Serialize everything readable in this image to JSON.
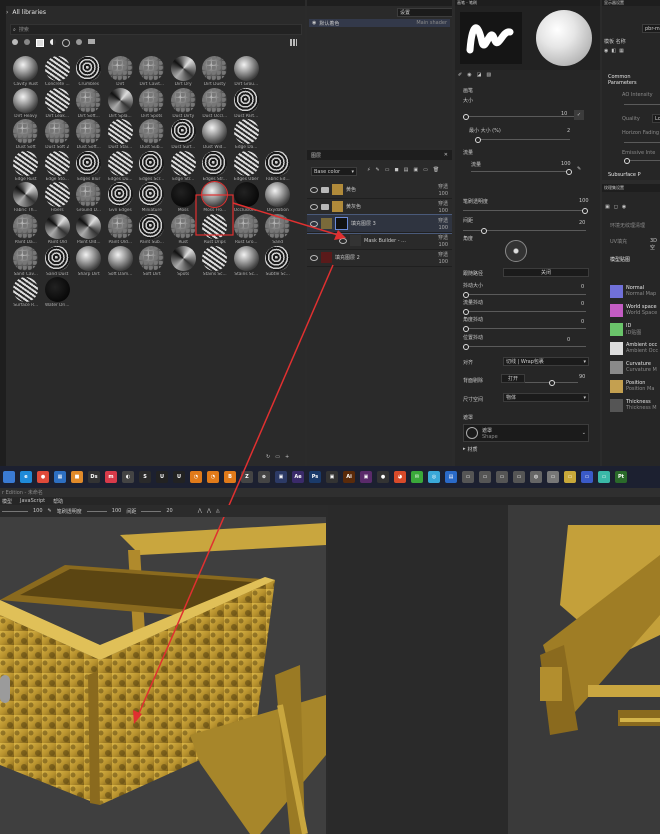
{
  "library": {
    "breadcrumb": "All libraries",
    "search_placeholder": "搜索",
    "items": [
      {
        "label": "Cavity Rust",
        "v": "v2"
      },
      {
        "label": "Concrete ...",
        "v": "v1"
      },
      {
        "label": "Crumbles",
        "v": "v4"
      },
      {
        "label": "Dirt",
        "v": "v3"
      },
      {
        "label": "Dirt Cavit...",
        "v": "v3"
      },
      {
        "label": "Dirt Dry",
        "v": "v6"
      },
      {
        "label": "Dirt Dusty",
        "v": "v3"
      },
      {
        "label": "Dirt Grou...",
        "v": "v2"
      },
      {
        "label": "",
        "v": ""
      },
      {
        "label": "Dirt Heavy",
        "v": "v2"
      },
      {
        "label": "Dirt Leak...",
        "v": "v1"
      },
      {
        "label": "Dirt Soft...",
        "v": "v3"
      },
      {
        "label": "Dirt Spla...",
        "v": "v6"
      },
      {
        "label": "Dirt Spots",
        "v": "v3"
      },
      {
        "label": "Dust Dirty",
        "v": "v3"
      },
      {
        "label": "Dust Occl...",
        "v": "v3"
      },
      {
        "label": "Dust Part...",
        "v": "v4"
      },
      {
        "label": "",
        "v": ""
      },
      {
        "label": "Dust Soft",
        "v": "v3"
      },
      {
        "label": "Dust Soft 2",
        "v": "v3"
      },
      {
        "label": "Dust Soft...",
        "v": "v3"
      },
      {
        "label": "Dust Stai...",
        "v": "v1"
      },
      {
        "label": "Dust Sub...",
        "v": "v3"
      },
      {
        "label": "Dust Surf...",
        "v": "v4"
      },
      {
        "label": "Dust Wid...",
        "v": "v2"
      },
      {
        "label": "Edge Da...",
        "v": "v1"
      },
      {
        "label": "",
        "v": ""
      },
      {
        "label": "Edge Rust",
        "v": "v1"
      },
      {
        "label": "Edge Sto...",
        "v": "v1"
      },
      {
        "label": "Edges Blur",
        "v": "v4"
      },
      {
        "label": "Edges Du...",
        "v": "v1"
      },
      {
        "label": "Edges Scr...",
        "v": "v4"
      },
      {
        "label": "Edge Str...",
        "v": "v1"
      },
      {
        "label": "Edges Str...",
        "v": "v4"
      },
      {
        "label": "Edges Uber",
        "v": "v1"
      },
      {
        "label": "Fabric Ed...",
        "v": "v4"
      },
      {
        "label": "Fabric Th...",
        "v": "v6"
      },
      {
        "label": "Fibers",
        "v": "v1"
      },
      {
        "label": "Ground D...",
        "v": "v3"
      },
      {
        "label": "Gvn Edges",
        "v": "v4"
      },
      {
        "label": "Miniature",
        "v": "v4"
      },
      {
        "label": "Moss",
        "v": "v5"
      },
      {
        "label": "Moss Fro...",
        "v": "v2"
      },
      {
        "label": "Occlusion...",
        "v": "v5"
      },
      {
        "label": "Oxydation",
        "v": "v2"
      },
      {
        "label": "Paint Da...",
        "v": "v3"
      },
      {
        "label": "Paint Old",
        "v": "v6"
      },
      {
        "label": "Paint Old...",
        "v": "v6"
      },
      {
        "label": "Paint Old...",
        "v": "v3"
      },
      {
        "label": "Paint Sub...",
        "v": "v4"
      },
      {
        "label": "Rust",
        "v": "v3"
      },
      {
        "label": "Rust Drips",
        "v": "v1"
      },
      {
        "label": "Rust Gro...",
        "v": "v3"
      },
      {
        "label": "Sand",
        "v": "v3"
      },
      {
        "label": "Sand Cav...",
        "v": "v3"
      },
      {
        "label": "Sand Dust",
        "v": "v4"
      },
      {
        "label": "Sharp Dirt",
        "v": "v2"
      },
      {
        "label": "Soft Dam...",
        "v": "v2"
      },
      {
        "label": "Soft Dirt",
        "v": "v3"
      },
      {
        "label": "Spots",
        "v": "v6"
      },
      {
        "label": "Stains Sc...",
        "v": "v1"
      },
      {
        "label": "Stains Sc...",
        "v": "v2"
      },
      {
        "label": "Subtle Sc...",
        "v": "v4"
      },
      {
        "label": "Surface R...",
        "v": "v1"
      },
      {
        "label": "Water Dri...",
        "v": "v5"
      },
      {
        "label": "",
        "v": ""
      },
      {
        "label": "",
        "v": ""
      },
      {
        "label": "",
        "v": ""
      },
      {
        "label": "",
        "v": ""
      },
      {
        "label": "",
        "v": ""
      },
      {
        "label": "",
        "v": ""
      },
      {
        "label": "",
        "v": ""
      }
    ]
  },
  "shader": {
    "dropdown": "设置",
    "item": "默认着色",
    "value": "Main shader"
  },
  "layers": {
    "title": "图层",
    "blend": "Base color",
    "rows": [
      {
        "name": "黄色",
        "blend": "穿透",
        "opacity": "100",
        "color": "#b08a3a"
      },
      {
        "name": "黄灰色",
        "blend": "穿透",
        "opacity": "100",
        "color": "#b08a3a"
      },
      {
        "name": "填充图层 3",
        "blend": "穿透",
        "opacity": "100",
        "color": "#7a6a3a"
      },
      {
        "name": "Mask Builder - ...",
        "blend": "穿透",
        "opacity": "100",
        "color": "#333"
      },
      {
        "name": "填充图层 2",
        "blend": "穿透",
        "opacity": "100",
        "color": "#5a1a1a"
      }
    ]
  },
  "brush": {
    "title": "画笔 - 笔刷"
  },
  "props": {
    "section": "画笔",
    "size_label": "大小",
    "size_value": "10",
    "min_size_label": "最小 大小 (%)",
    "min_size_value": "2",
    "flow_section": "流量",
    "flow_label": "流量",
    "flow_value": "100",
    "opacity_label": "笔刷透明度",
    "opacity_value": "100",
    "spacing_label": "间距",
    "spacing_value": "20",
    "angle_label": "角度",
    "follow_label": "跟随路径",
    "follow_value": "关闭",
    "jitter_size_label": "抖动大小",
    "jitter_size_value": "0",
    "jitter_flow_label": "流量抖动",
    "jitter_flow_value": "0",
    "jitter_angle_label": "角度抖动",
    "jitter_angle_value": "0",
    "pos_jitter_label": "位置抖动",
    "pos_jitter_value": "0",
    "align_label": "对齐",
    "align_value": "切线 | Wrap包裹",
    "backface_label": "背面剔除",
    "backface_value": "打开",
    "backface_num": "90",
    "size_space_label": "尺寸空间",
    "size_space_value": "物体",
    "alpha_section": "遮罩",
    "alpha_name": "遮罩",
    "alpha_type": "Shape",
    "material_section": "材质"
  },
  "display": {
    "title": "显示器设置",
    "common": "Common Parameters",
    "ao": "AO Intensity",
    "quality_label": "Quality",
    "quality_value": "Lo",
    "horizon": "Horizon Fading",
    "emissive": "Emissive Inte",
    "subsurface": "Subsurface P",
    "mode_label": "模板 名称",
    "mode_value": "pbr-m"
  },
  "texture_set": {
    "title": "纹理集设置",
    "res_label": "环境无纹理清理",
    "ui_label": "UV填充",
    "ui_value": "3D空",
    "channels_title": "模型贴图",
    "channels": [
      {
        "name": "Normal",
        "desc": "Normal Map",
        "color": "#7070d8"
      },
      {
        "name": "World space",
        "desc": "World Space",
        "color": "#c35cc3"
      },
      {
        "name": "ID",
        "desc": "ID贴图",
        "color": "#6ac46a"
      },
      {
        "name": "Ambient occ",
        "desc": "Ambient Occ",
        "color": "#dddddd"
      },
      {
        "name": "Curvature",
        "desc": "Curvature M",
        "color": "#8a8a8a"
      },
      {
        "name": "Position",
        "desc": "Position Ma",
        "color": "#c4a050"
      },
      {
        "name": "Thickness",
        "desc": "Thickness M",
        "color": "#555555"
      }
    ]
  },
  "taskbar": {
    "icons": [
      {
        "t": "",
        "c": "#3a7bd5"
      },
      {
        "t": "e",
        "c": "#1f8ad8"
      },
      {
        "t": "●",
        "c": "#de4a3a"
      },
      {
        "t": "▦",
        "c": "#2d6fc2"
      },
      {
        "t": "■",
        "c": "#e08a2a"
      },
      {
        "t": "Ds",
        "c": "#333"
      },
      {
        "t": "m",
        "c": "#d83a4a"
      },
      {
        "t": "◐",
        "c": "#444"
      },
      {
        "t": "S",
        "c": "#2a2a2a"
      },
      {
        "t": "U",
        "c": "#222"
      },
      {
        "t": "U",
        "c": "#222"
      },
      {
        "t": "◔",
        "c": "#e07a1a"
      },
      {
        "t": "◔",
        "c": "#e07a1a"
      },
      {
        "t": "B",
        "c": "#e07a1a"
      },
      {
        "t": "Z",
        "c": "#444"
      },
      {
        "t": "⊗",
        "c": "#444"
      },
      {
        "t": "▣",
        "c": "#2c3a66"
      },
      {
        "t": "Ae",
        "c": "#3a2a6a"
      },
      {
        "t": "Ps",
        "c": "#1a3a6a"
      },
      {
        "t": "▣",
        "c": "#333"
      },
      {
        "t": "Ai",
        "c": "#5a2a0a"
      },
      {
        "t": "▣",
        "c": "#5a2a6a"
      },
      {
        "t": "●",
        "c": "#333"
      },
      {
        "t": "◕",
        "c": "#d84a2a"
      },
      {
        "t": "✉",
        "c": "#3aa83a"
      },
      {
        "t": "◎",
        "c": "#3aa8d8"
      },
      {
        "t": "▤",
        "c": "#2a6ac8"
      },
      {
        "t": "▭",
        "c": "#555"
      },
      {
        "t": "▭",
        "c": "#555"
      },
      {
        "t": "▭",
        "c": "#555"
      },
      {
        "t": "▭",
        "c": "#555"
      },
      {
        "t": "◍",
        "c": "#666"
      },
      {
        "t": "▭",
        "c": "#777"
      },
      {
        "t": "▭",
        "c": "#c8a83a"
      },
      {
        "t": "▭",
        "c": "#3a5ac8"
      },
      {
        "t": "▭",
        "c": "#3ab8a8"
      },
      {
        "t": "Pt",
        "c": "#2a6a2a"
      }
    ]
  },
  "menubar": {
    "title": "r Edition - 未命名",
    "menu1": "模型",
    "menu2": "JavaScript",
    "menu3": "帮助"
  },
  "toolbar2": {
    "v1": "100",
    "label1": "笔刷透明度",
    "v2": "100",
    "label2": "间距",
    "v3": "20"
  },
  "viewport": {
    "mode": "材质"
  }
}
